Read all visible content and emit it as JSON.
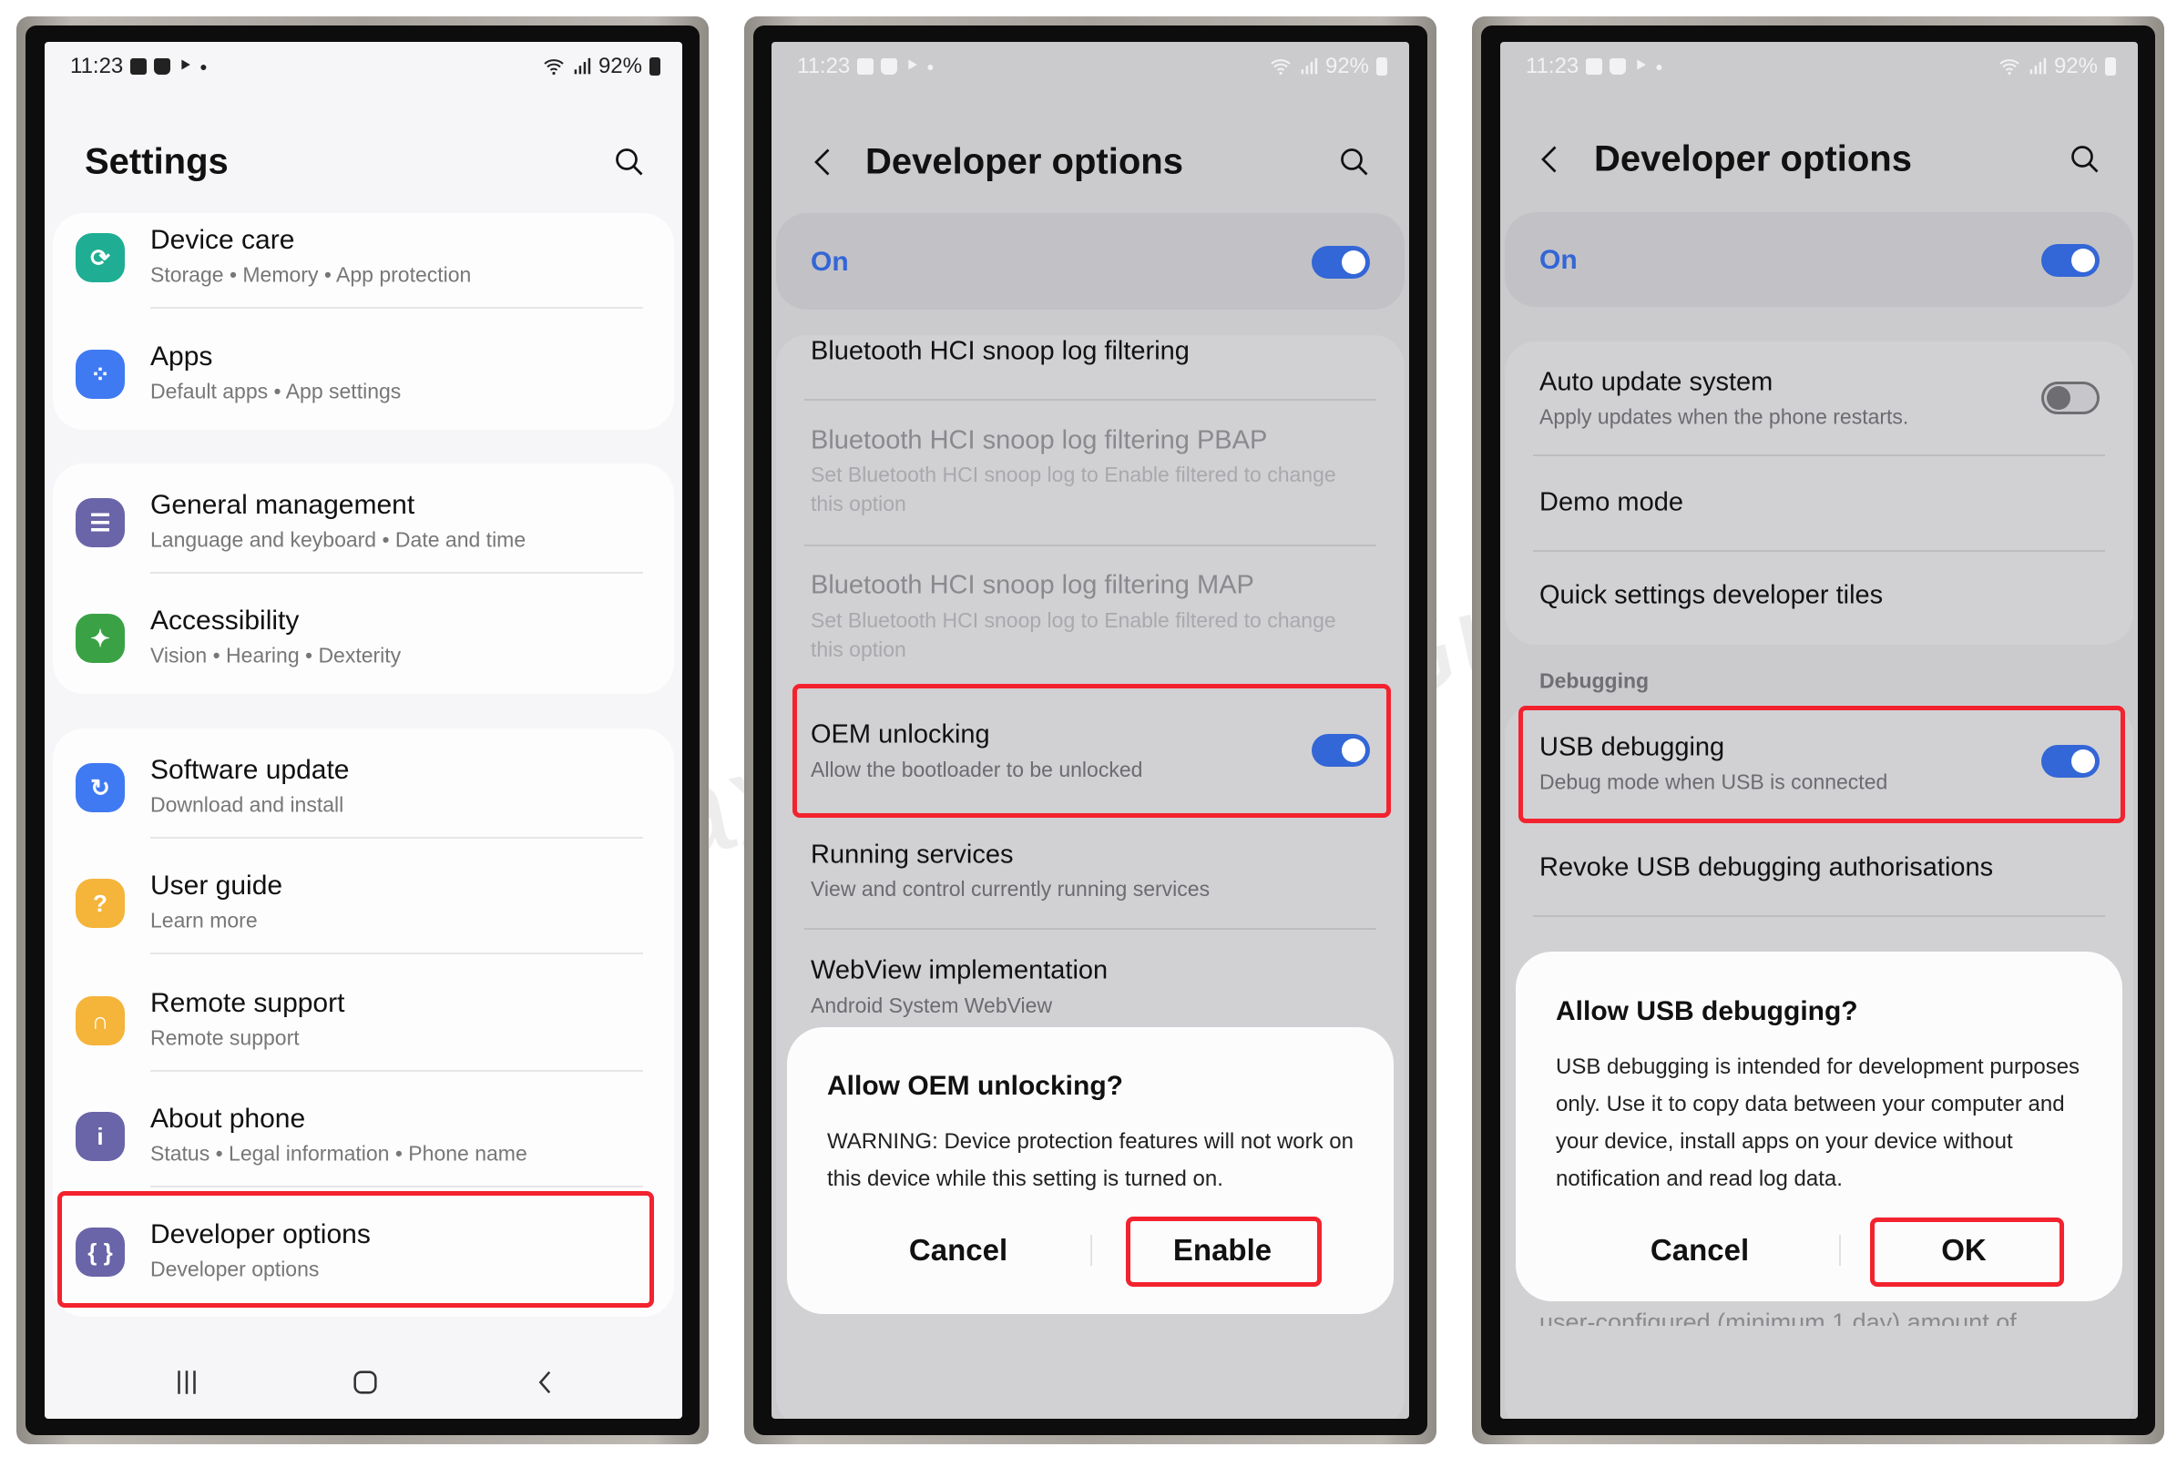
{
  "watermark": "www.GalaxyS24UltraGuide.com",
  "colors": {
    "accent_blue": "#3366d6",
    "highlight_red": "#f2232e",
    "toggle_off": "#6e6e72"
  },
  "status_bar": {
    "time": "11:23",
    "battery": "92%",
    "left_icons": [
      "gallery-icon",
      "shopping-bag-icon",
      "play-store-icon",
      "dot-icon"
    ],
    "right_icons": [
      "wifi-icon",
      "signal-icon",
      "battery-charging-icon"
    ]
  },
  "screens": [
    {
      "title": "Settings",
      "items": [
        {
          "title": "Device care",
          "subtitle": "Storage  •  Memory  •  App protection",
          "icon": "device-care-icon",
          "color": "#1fae93"
        },
        {
          "title": "Apps",
          "subtitle": "Default apps  •  App settings",
          "icon": "apps-icon",
          "color": "#3f7af2"
        },
        {
          "title": "General management",
          "subtitle": "Language and keyboard  •  Date and time",
          "icon": "sliders-icon",
          "color": "#6a64a8"
        },
        {
          "title": "Accessibility",
          "subtitle": "Vision  •  Hearing  •  Dexterity",
          "icon": "accessibility-icon",
          "color": "#3aa245"
        },
        {
          "title": "Software update",
          "subtitle": "Download and install",
          "icon": "software-update-icon",
          "color": "#3f7af2"
        },
        {
          "title": "User guide",
          "subtitle": "Learn more",
          "icon": "user-guide-icon",
          "color": "#f5b43a"
        },
        {
          "title": "Remote support",
          "subtitle": "Remote support",
          "icon": "headset-icon",
          "color": "#f5b43a"
        },
        {
          "title": "About phone",
          "subtitle": "Status  •  Legal information  •  Phone name",
          "icon": "info-icon",
          "color": "#6a64a8"
        },
        {
          "title": "Developer options",
          "subtitle": "Developer options",
          "icon": "braces-icon",
          "color": "#6a64a8",
          "highlighted": true
        }
      ]
    },
    {
      "title": "Developer options",
      "master_toggle": {
        "label": "On",
        "on": true
      },
      "items": [
        {
          "title": "Bluetooth HCI snoop log filtering",
          "subtitle": "",
          "enabled": true
        },
        {
          "title": "Bluetooth HCI snoop log filtering PBAP",
          "subtitle": "Set Bluetooth HCI snoop log to Enable filtered to change this option",
          "enabled": false
        },
        {
          "title": "Bluetooth HCI snoop log filtering MAP",
          "subtitle": "Set Bluetooth HCI snoop log to Enable filtered to change this option",
          "enabled": false
        },
        {
          "title": "OEM unlocking",
          "subtitle": "Allow the bootloader to be unlocked",
          "enabled": true,
          "toggle": true,
          "highlighted": true
        },
        {
          "title": "Running services",
          "subtitle": "View and control currently running services",
          "enabled": true
        },
        {
          "title": "WebView implementation",
          "subtitle": "Android System WebView",
          "enabled": true
        }
      ],
      "dialog": {
        "title": "Allow OEM unlocking?",
        "body": "WARNING: Device protection features will not work on this device while this setting is turned on.",
        "cancel": "Cancel",
        "confirm": "Enable"
      }
    },
    {
      "title": "Developer options",
      "master_toggle": {
        "label": "On",
        "on": true
      },
      "items": [
        {
          "title": "Auto update system",
          "subtitle": "Apply updates when the phone restarts.",
          "toggle": false
        },
        {
          "title": "Demo mode",
          "subtitle": ""
        },
        {
          "title": "Quick settings developer tiles",
          "subtitle": ""
        },
        {
          "title": "USB debugging",
          "subtitle": "Debug mode when USB is connected",
          "toggle": true,
          "highlighted": true
        },
        {
          "title": "Revoke USB debugging authorisations",
          "subtitle": ""
        }
      ],
      "section_header": "Debugging",
      "dialog": {
        "title": "Allow USB debugging?",
        "body": "USB debugging is intended for development purposes only. Use it to copy data between your computer and your device, install apps on your device without notification and read log data.",
        "cancel": "Cancel",
        "confirm": "OK"
      },
      "clipped_text": "user-configured (minimum 1 day) amount of"
    }
  ]
}
